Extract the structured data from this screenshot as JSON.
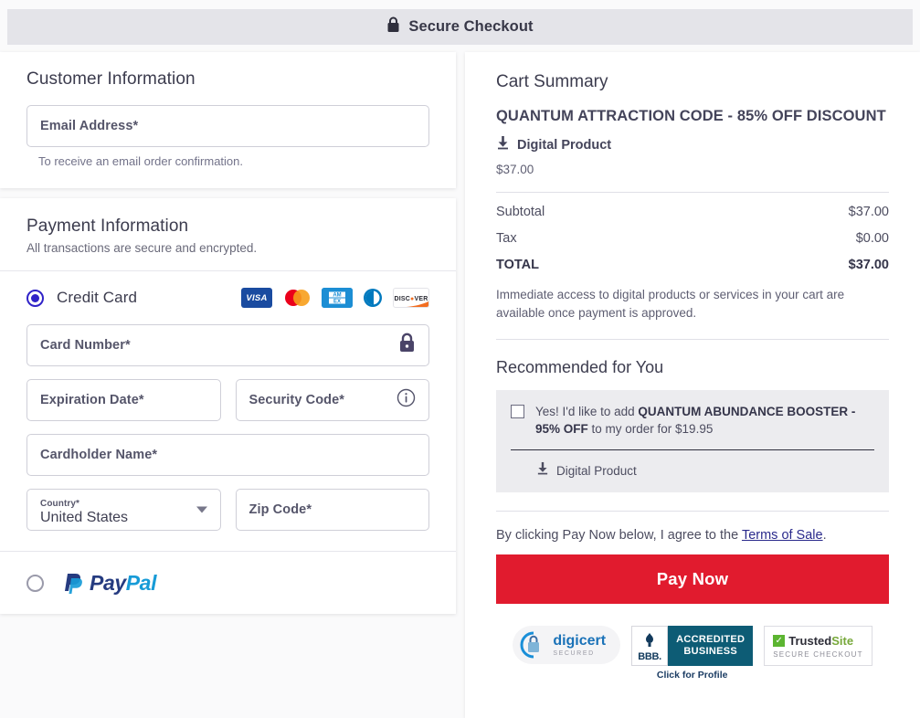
{
  "header": {
    "title": "Secure Checkout",
    "icon": "lock-icon"
  },
  "customer": {
    "section_title": "Customer Information",
    "email_placeholder": "Email Address*",
    "helper": "To receive an email order confirmation."
  },
  "payment": {
    "section_title": "Payment Information",
    "section_sub": "All transactions are secure and encrypted.",
    "credit_card_label": "Credit Card",
    "paypal_label": "PayPal",
    "selected_method": "credit-card",
    "brands": [
      "VISA",
      "Mastercard",
      "AMEX",
      "Diners Club",
      "DISCOVER"
    ],
    "fields": {
      "card_number": "Card Number*",
      "expiration": "Expiration Date*",
      "security_code": "Security Code*",
      "cardholder": "Cardholder Name*",
      "country_label": "Country*",
      "country_value": "United States",
      "zip": "Zip Code*"
    },
    "paypal_word_1": "Pay",
    "paypal_word_2": "Pal"
  },
  "cart": {
    "title": "Cart Summary",
    "product_name": "QUANTUM ATTRACTION CODE - 85% OFF DISCOUNT",
    "digital_label": "Digital Product",
    "product_price": "$37.00",
    "lines": [
      {
        "label": "Subtotal",
        "value": "$37.00"
      },
      {
        "label": "Tax",
        "value": "$0.00"
      }
    ],
    "total_label": "TOTAL",
    "total_value": "$37.00",
    "note": "Immediate access to digital products or services in your cart are available once payment is approved."
  },
  "recommended": {
    "title": "Recommended for You",
    "offer_prefix": "Yes! I'd like to add ",
    "offer_bold": "QUANTUM ABUNDANCE BOOSTER - 95% OFF",
    "offer_suffix": " to my order for $19.95",
    "digital_label": "Digital Product",
    "checked": false
  },
  "checkout": {
    "terms_prefix": "By clicking Pay Now below, I agree to the ",
    "terms_link": "Terms of Sale",
    "terms_suffix": ".",
    "pay_button": "Pay Now",
    "pay_button_color": "#e11b2e"
  },
  "badges": {
    "digicert_name": "digicert",
    "digicert_sub": "SECURED",
    "bbb_abbr": "BBB.",
    "bbb_line1": "ACCREDITED",
    "bbb_line2": "BUSINESS",
    "bbb_cta": "Click for Profile",
    "trustedsite_1": "Trusted",
    "trustedsite_2": "Site",
    "trustedsite_sub": "SECURE CHECKOUT"
  }
}
